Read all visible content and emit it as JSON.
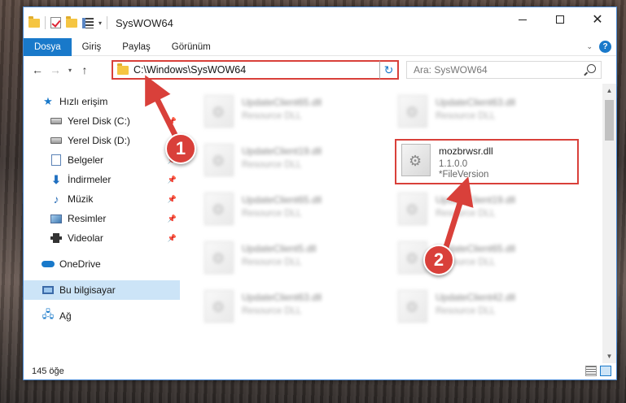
{
  "window": {
    "title": "SysWOW64"
  },
  "ribbon": {
    "tabs": [
      "Dosya",
      "Giriş",
      "Paylaş",
      "Görünüm"
    ]
  },
  "address": {
    "path": "C:\\Windows\\SysWOW64"
  },
  "search": {
    "placeholder": "Ara: SysWOW64"
  },
  "sidebar": {
    "items": [
      {
        "label": "Hızlı erişim",
        "icon": "star-icon"
      },
      {
        "label": "Yerel Disk (C:)",
        "icon": "disk-icon"
      },
      {
        "label": "Yerel Disk (D:)",
        "icon": "disk-icon"
      },
      {
        "label": "Belgeler",
        "icon": "document-icon"
      },
      {
        "label": "İndirmeler",
        "icon": "download-icon"
      },
      {
        "label": "Müzik",
        "icon": "music-icon"
      },
      {
        "label": "Resimler",
        "icon": "pictures-icon"
      },
      {
        "label": "Videolar",
        "icon": "videos-icon"
      },
      {
        "label": "OneDrive",
        "icon": "cloud-icon"
      },
      {
        "label": "Bu bilgisayar",
        "icon": "computer-icon"
      },
      {
        "label": "Ağ",
        "icon": "network-icon"
      }
    ]
  },
  "files": [
    {
      "name": "UpdateClient65.dll",
      "sub": "Resource DLL"
    },
    {
      "name": "UpdateClient63.dll",
      "sub": "Resource DLL"
    },
    {
      "name": "UpdateClient19.dll",
      "sub": "Resource DLL"
    },
    {
      "name": "mozbrwsr.dll",
      "sub": "1.1.0.0",
      "sub2": "*FileVersion"
    },
    {
      "name": "UpdateClient65.dll",
      "sub": "Resource DLL"
    },
    {
      "name": "UpdateClient19.dll",
      "sub": "Resource DLL"
    },
    {
      "name": "UpdateClient5.dll",
      "sub": "Resource DLL"
    },
    {
      "name": "UpdateClient65.dll",
      "sub": "Resource DLL"
    },
    {
      "name": "UpdateClient63.dll",
      "sub": "Resource DLL"
    },
    {
      "name": "UpdateClient42.dll",
      "sub": "Resource DLL"
    }
  ],
  "status": {
    "count": "145 öğe"
  },
  "callouts": [
    "1",
    "2"
  ],
  "colors": {
    "accent": "#1979ca",
    "highlight": "#d9403a",
    "selected": "#cce4f7"
  }
}
